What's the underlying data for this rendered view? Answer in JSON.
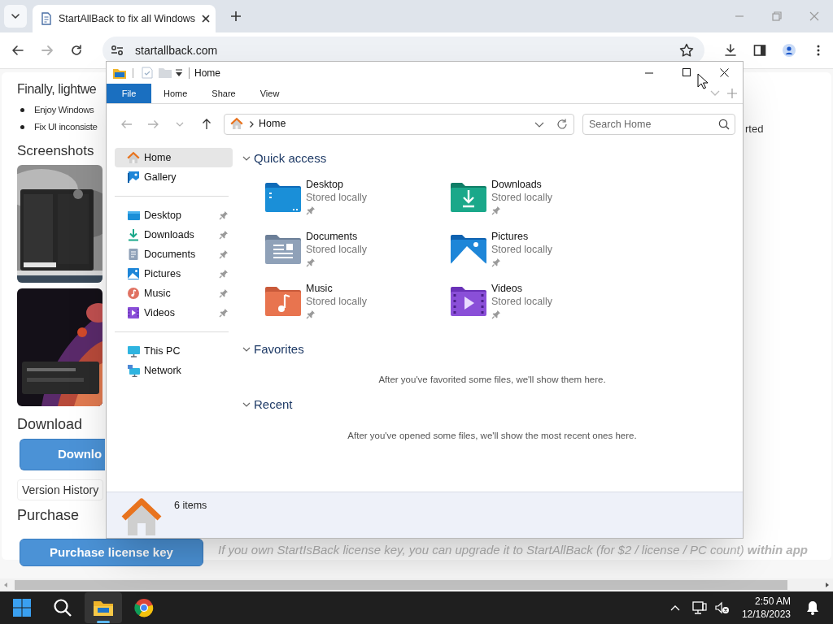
{
  "browser": {
    "tabs": [
      {
        "title": "StartAllBack to fix all Windows",
        "selected": true
      }
    ],
    "address": "startallback.com"
  },
  "webpage": {
    "heading": "Finally, lightwe",
    "bullets": [
      "Enjoy Windows",
      "Fix UI inconsiste"
    ],
    "screenshots_heading": "Screenshots",
    "screenshots": [
      {
        "kind": "picture"
      },
      {
        "kind": "picture"
      }
    ],
    "download_heading": "Download",
    "download_button": "Downlo",
    "version_history": "Version History",
    "purchase_heading": "Purchase",
    "purchase_button": "Purchase license key",
    "upgrade_note": "If you own StartIsBack license key, you can upgrade it to StartAllBack (for $2 / license / PC count) **within app**",
    "side_text": "rted"
  },
  "explorer": {
    "title": "Home",
    "ribbon_tabs": [
      {
        "label": "File",
        "kind": "file"
      },
      {
        "label": "Home",
        "kind": "tab"
      },
      {
        "label": "Share",
        "kind": "tab"
      },
      {
        "label": "View",
        "kind": "tab"
      }
    ],
    "location": "Home",
    "search": {
      "placeholder": "Search Home"
    },
    "sidebar": {
      "groups": [
        {
          "items": [
            {
              "label": "Home",
              "kind": "home",
              "selected": true,
              "pinned": false
            },
            {
              "label": "Gallery",
              "kind": "gallery",
              "selected": false,
              "pinned": false
            }
          ]
        },
        {
          "items": [
            {
              "label": "Desktop",
              "kind": "desktop",
              "selected": false,
              "pinned": true
            },
            {
              "label": "Downloads",
              "kind": "downloads",
              "selected": false,
              "pinned": true
            },
            {
              "label": "Documents",
              "kind": "documents",
              "selected": false,
              "pinned": true
            },
            {
              "label": "Pictures",
              "kind": "pictures",
              "selected": false,
              "pinned": true
            },
            {
              "label": "Music",
              "kind": "music",
              "selected": false,
              "pinned": true
            },
            {
              "label": "Videos",
              "kind": "videos",
              "selected": false,
              "pinned": true
            }
          ]
        },
        {
          "items": [
            {
              "label": "This PC",
              "kind": "thispc",
              "selected": false,
              "pinned": false
            },
            {
              "label": "Network",
              "kind": "network",
              "selected": false,
              "pinned": false
            }
          ]
        }
      ]
    },
    "quick_access": {
      "title": "Quick access",
      "expanded": true,
      "items": [
        {
          "name": "Desktop",
          "status": "Stored locally",
          "kind": "desktop",
          "pinned": true
        },
        {
          "name": "Downloads",
          "status": "Stored locally",
          "kind": "downloads",
          "pinned": true
        },
        {
          "name": "Documents",
          "status": "Stored locally",
          "kind": "documents",
          "pinned": true
        },
        {
          "name": "Pictures",
          "status": "Stored locally",
          "kind": "pictures",
          "pinned": true
        },
        {
          "name": "Music",
          "status": "Stored locally",
          "kind": "music",
          "pinned": true
        },
        {
          "name": "Videos",
          "status": "Stored locally",
          "kind": "videos",
          "pinned": true
        }
      ]
    },
    "favorites": {
      "title": "Favorites",
      "expanded": true,
      "message": "After you've favorited some files, we'll show them here."
    },
    "recent": {
      "title": "Recent",
      "expanded": true,
      "message": "After you've opened some files, we'll show the most recent ones here."
    },
    "status": "6 items"
  },
  "taskbar": {
    "apps": [
      {
        "kind": "start",
        "selected": false
      },
      {
        "kind": "search",
        "selected": false
      },
      {
        "kind": "explorer",
        "selected": true
      },
      {
        "kind": "chrome",
        "selected": false
      }
    ],
    "time": "2:50 AM",
    "date": "12/18/2023"
  }
}
